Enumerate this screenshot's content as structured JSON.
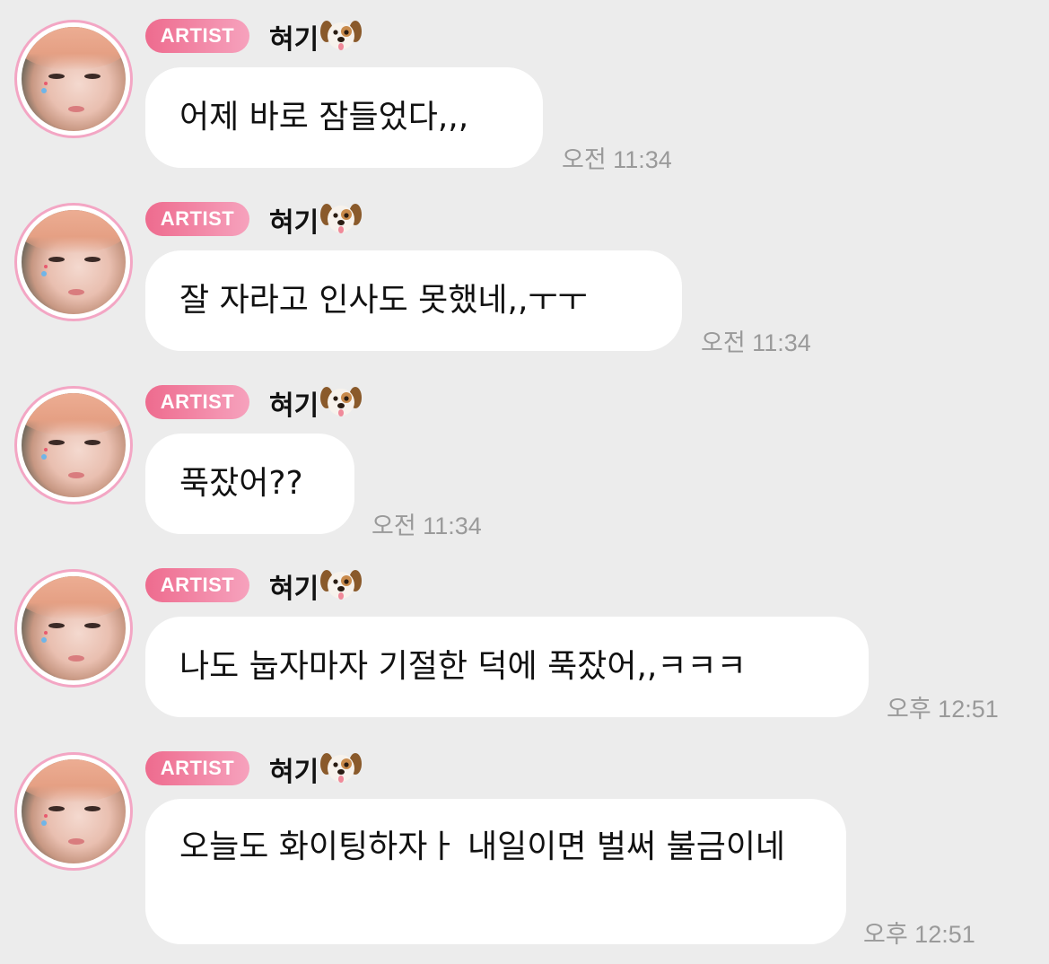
{
  "messages": [
    {
      "badge": "ARTIST",
      "sender": "혀기",
      "sender_emoji": "dog-face",
      "text": "어제 바로 잠들었다,,,",
      "time": "오전 11:34"
    },
    {
      "badge": "ARTIST",
      "sender": "혀기",
      "sender_emoji": "dog-face",
      "text": "잘 자라고 인사도 못했네,,ㅜㅜ",
      "time": "오전 11:34"
    },
    {
      "badge": "ARTIST",
      "sender": "혀기",
      "sender_emoji": "dog-face",
      "text": "푹잤어??",
      "time": "오전 11:34"
    },
    {
      "badge": "ARTIST",
      "sender": "혀기",
      "sender_emoji": "dog-face",
      "text": "나도 눕자마자 기절한 덕에 푹잤어,,ㅋㅋㅋ",
      "time": "오후 12:51"
    },
    {
      "badge": "ARTIST",
      "sender": "혀기",
      "sender_emoji": "dog-face",
      "text": "오늘도 화이팅하자ㅏ 내일이면 벌써 불금이네",
      "time": "오후 12:51"
    }
  ],
  "colors": {
    "background": "#ececec",
    "bubble": "#ffffff",
    "badge_start": "#ee6b8e",
    "badge_end": "#f6a2bd",
    "avatar_ring": "#f3a6c4",
    "timestamp": "#9a9a9a"
  }
}
